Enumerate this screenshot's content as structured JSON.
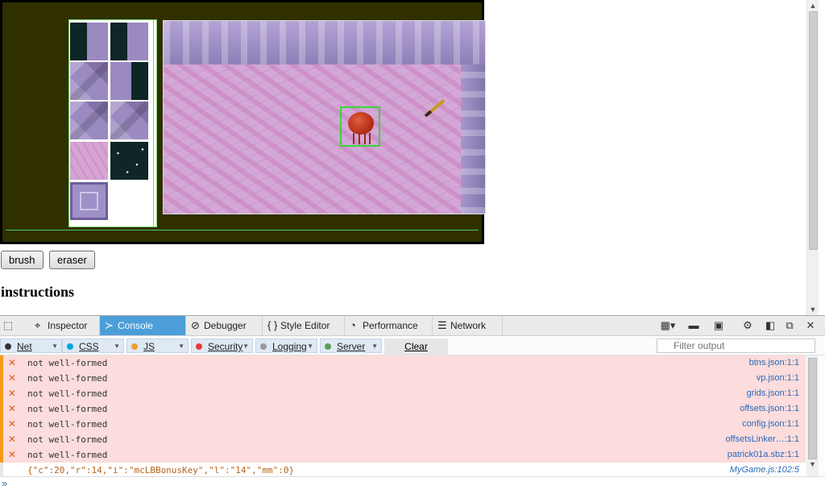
{
  "game": {
    "palette_tiles": [
      "tile-space-rock",
      "tile-space-rock",
      "tile-rock",
      "tile-rock-space",
      "tile-rock",
      "tile-rock",
      "tile-pink",
      "tile-space",
      "tile-block"
    ],
    "tools": {
      "brush_label": "brush",
      "eraser_label": "eraser"
    },
    "instructions_heading": "instructions"
  },
  "devtools": {
    "tabs": [
      {
        "label": "Inspector",
        "icon": "inspector-icon",
        "active": false
      },
      {
        "label": "Console",
        "icon": "console-icon",
        "active": true
      },
      {
        "label": "Debugger",
        "icon": "debugger-icon",
        "active": false
      },
      {
        "label": "Style Editor",
        "icon": "style-editor-icon",
        "active": false
      },
      {
        "label": "Performance",
        "icon": "performance-icon",
        "active": false
      },
      {
        "label": "Network",
        "icon": "network-icon",
        "active": false
      }
    ],
    "filters": [
      {
        "label": "Net",
        "color": "#333333"
      },
      {
        "label": "CSS",
        "color": "#00a8e0"
      },
      {
        "label": "JS",
        "color": "#f0a030"
      },
      {
        "label": "Security",
        "color": "#e83a3a"
      },
      {
        "label": "Logging",
        "color": "#999999"
      },
      {
        "label": "Server",
        "color": "#5aa05a"
      }
    ],
    "clear_label": "Clear",
    "filter_placeholder": "Filter output",
    "logs": [
      {
        "type": "error",
        "message": "not well-formed",
        "location": "btns.json:1:1"
      },
      {
        "type": "error",
        "message": "not well-formed",
        "location": "vp.json:1:1"
      },
      {
        "type": "error",
        "message": "not well-formed",
        "location": "grids.json:1:1"
      },
      {
        "type": "error",
        "message": "not well-formed",
        "location": "offsets.json:1:1"
      },
      {
        "type": "error",
        "message": "not well-formed",
        "location": "config.json:1:1"
      },
      {
        "type": "error",
        "message": "not well-formed",
        "location": "offsetsLinker…:1:1"
      },
      {
        "type": "error",
        "message": "not well-formed",
        "location": "patrick01a.sbz:1:1"
      },
      {
        "type": "log",
        "message": "{\"c\":20,\"r\":14,\"i\":\"mcLBBonusKey\",\"l\":\"14\",\"mm\":0}",
        "location": "MyGame.js:102:5"
      }
    ]
  },
  "colors": {
    "accent": "#4c9ed9",
    "error_bg": "#fcdcdc",
    "error_icon": "#e25c1c",
    "link": "#2a6ab7"
  }
}
